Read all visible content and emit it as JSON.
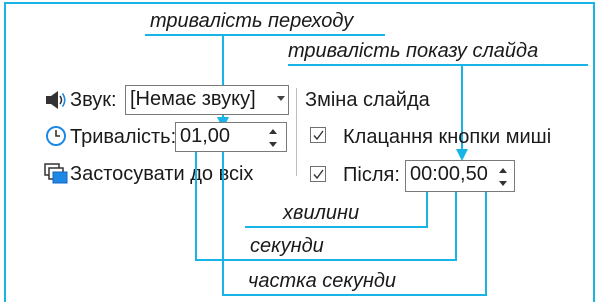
{
  "callouts": {
    "transition_duration": "тривалість переходу",
    "slide_show_duration": "тривалість показу слайда",
    "minutes": "хвилини",
    "seconds": "секунди",
    "fraction_of_second": "частка секунди"
  },
  "transition_panel": {
    "sound_label": "Звук:",
    "sound_value": "[Немає звуку]",
    "duration_label": "Тривалість:",
    "duration_value": "01,00",
    "apply_all_label": "Застосувати до всіх"
  },
  "advance_slide": {
    "heading": "Зміна слайда",
    "on_click_label": "Клацання кнопки миші",
    "on_click_checked": true,
    "after_label": "Після:",
    "after_checked": true,
    "after_value": "00:00,50"
  },
  "colors": {
    "accent": "#19b4e6",
    "icon_blue": "#1e88e5"
  },
  "icons": [
    "speaker-icon",
    "clock-icon",
    "apply-all-icon",
    "checkmark-icon"
  ]
}
